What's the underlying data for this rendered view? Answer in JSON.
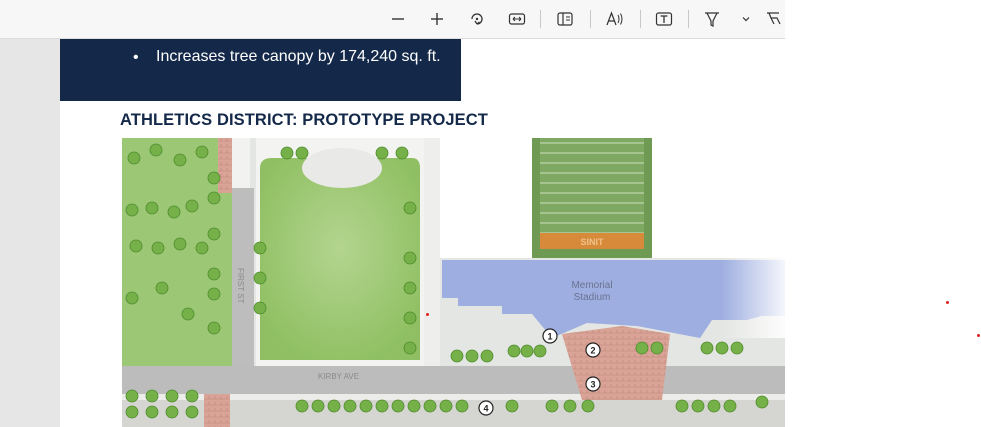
{
  "toolbar": {
    "buttons": [
      {
        "name": "zoom-out-button",
        "icon": "minus-icon"
      },
      {
        "name": "zoom-in-button",
        "icon": "plus-icon"
      },
      {
        "name": "rotate-button",
        "icon": "rotate-icon"
      },
      {
        "name": "fit-width-button",
        "icon": "fit-width-icon"
      },
      {
        "name": "page-view-button",
        "icon": "page-view-icon"
      },
      {
        "name": "read-aloud-button",
        "icon": "read-aloud-icon"
      },
      {
        "name": "text-button",
        "icon": "text-icon"
      },
      {
        "name": "highlight-button",
        "icon": "highlight-icon"
      },
      {
        "name": "highlight-options-button",
        "icon": "chevron-down-icon"
      },
      {
        "name": "draw-button",
        "icon": "draw-icon"
      }
    ]
  },
  "document": {
    "bullet": "Increases tree canopy by 174,240 sq. ft.",
    "heading": "ATHLETICS DISTRICT: PROTOTYPE PROJECT"
  },
  "map": {
    "labels": {
      "first_st": "FIRST ST",
      "kirby_ave": "KIRBY AVE",
      "stadium_line1": "Memorial",
      "stadium_line2": "Stadium",
      "field_text": "SINIT"
    },
    "markers": [
      "1",
      "2",
      "3",
      "4"
    ]
  }
}
